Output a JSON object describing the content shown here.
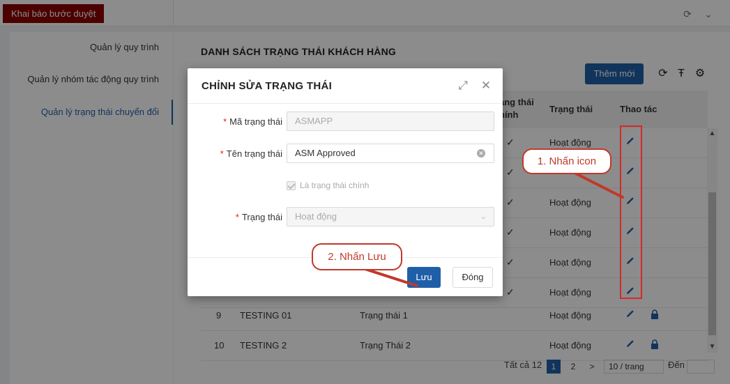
{
  "topbar": {
    "tab_label": "Khai báo bước duyệt"
  },
  "sidebar": {
    "items": [
      {
        "label": "Quản lý quy trình"
      },
      {
        "label": "Quản lý nhóm tác động quy trình"
      },
      {
        "label": "Quản lý trạng thái chuyển đổi"
      }
    ]
  },
  "main": {
    "title": "DANH SÁCH TRẠNG THÁI KHÁCH HÀNG",
    "add_button": "Thêm mới",
    "headers": {
      "main_status_line1": "ạng thái",
      "main_status_line2": "hính",
      "status": "Trạng thái",
      "actions": "Thao tác"
    },
    "rows": [
      {
        "status": "Hoạt động"
      },
      {
        "status": ""
      },
      {
        "status": "Hoạt động"
      },
      {
        "status": "Hoạt động"
      },
      {
        "status": "Hoạt động"
      },
      {
        "status": "Hoạt động"
      },
      {
        "no": "9",
        "code": "TESTING 01",
        "name": "Trạng thái 1",
        "status": "Hoạt động"
      },
      {
        "no": "10",
        "code": "TESTING 2",
        "name": "Trạng Thái 2",
        "status": "Hoạt động"
      }
    ],
    "pagination": {
      "total": "Tất cả 12",
      "page1": "1",
      "page2": "2",
      "next": ">",
      "page_size": "10 / trang",
      "goto": "Đến"
    }
  },
  "modal": {
    "title": "CHỈNH SỬA TRẠNG THÁI",
    "fields": {
      "code_label": "Mã trạng thái",
      "code_value": "ASMAPP",
      "name_label": "Tên trạng thái",
      "name_value": "ASM Approved",
      "main_checkbox_label": "Là trạng thái chính",
      "status_label": "Trạng thái",
      "status_value": "Hoạt động"
    },
    "save_button": "Lưu",
    "close_button": "Đóng"
  },
  "annotations": {
    "callout1": "1. Nhấn icon",
    "callout2": "2. Nhấn Lưu"
  },
  "colors": {
    "primary": "#1f5fa8",
    "brand_red": "#8b0000",
    "annotation_red": "#c0392b"
  }
}
